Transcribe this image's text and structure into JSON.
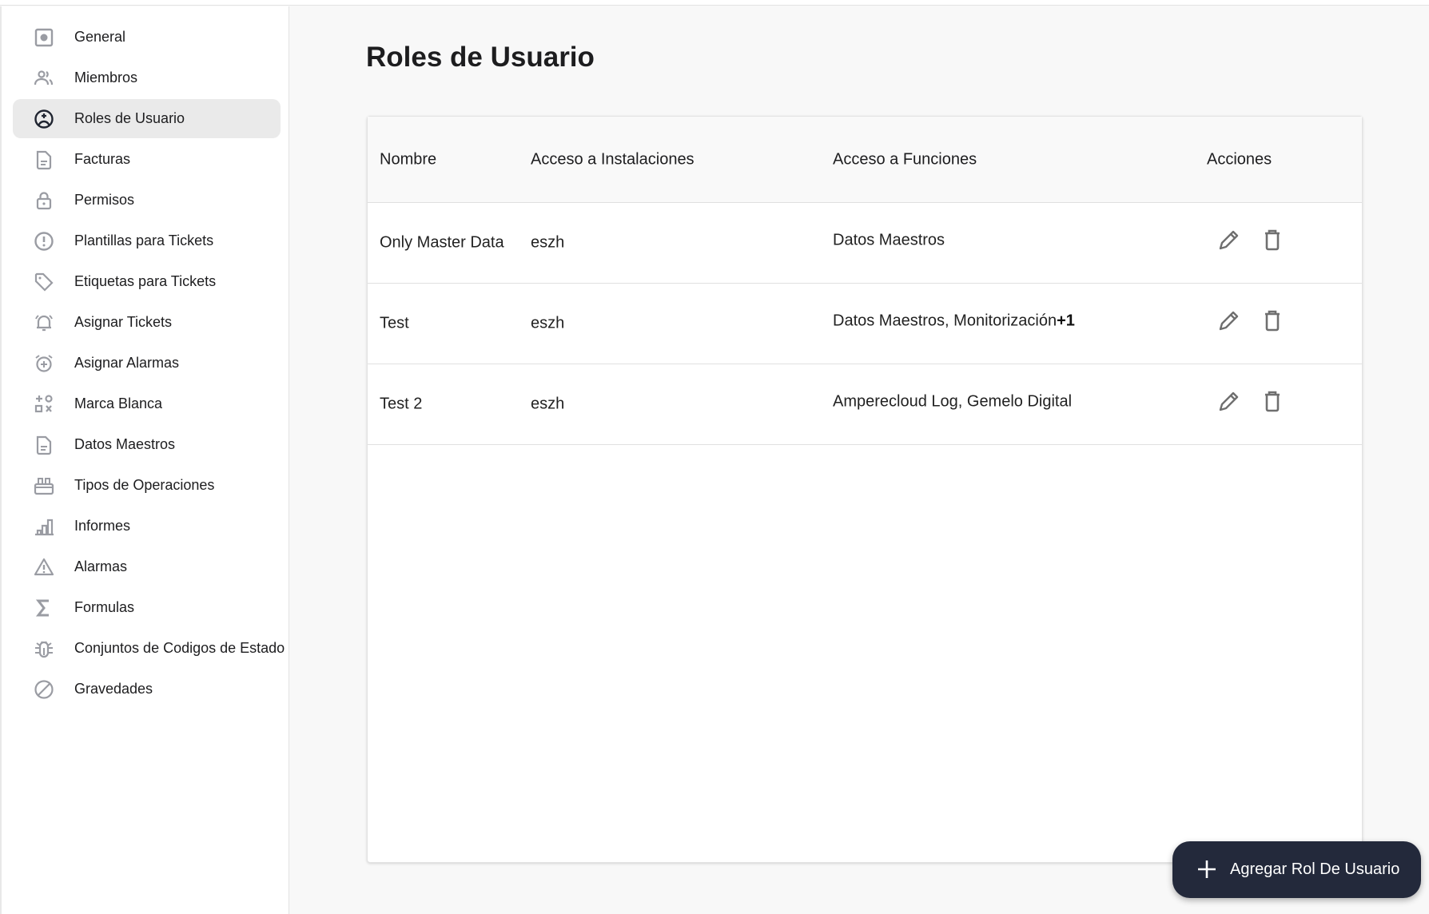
{
  "sidebar": {
    "items": [
      {
        "label": "General",
        "icon": "settings-box-icon",
        "active": false
      },
      {
        "label": "Miembros",
        "icon": "users-icon",
        "active": false
      },
      {
        "label": "Roles de Usuario",
        "icon": "user-circle-icon",
        "active": true
      },
      {
        "label": "Facturas",
        "icon": "document-icon",
        "active": false
      },
      {
        "label": "Permisos",
        "icon": "lock-icon",
        "active": false
      },
      {
        "label": "Plantillas para Tickets",
        "icon": "alert-circle-icon",
        "active": false
      },
      {
        "label": "Etiquetas para Tickets",
        "icon": "tag-icon",
        "active": false
      },
      {
        "label": "Asignar Tickets",
        "icon": "bell-ring-icon",
        "active": false
      },
      {
        "label": "Asignar Alarmas",
        "icon": "alarm-add-icon",
        "active": false
      },
      {
        "label": "Marca Blanca",
        "icon": "shapes-icon",
        "active": false
      },
      {
        "label": "Datos Maestros",
        "icon": "document-icon",
        "active": false
      },
      {
        "label": "Tipos de Operaciones",
        "icon": "toolbox-icon",
        "active": false
      },
      {
        "label": "Informes",
        "icon": "bar-chart-icon",
        "active": false
      },
      {
        "label": "Alarmas",
        "icon": "warning-icon",
        "active": false
      },
      {
        "label": "Formulas",
        "icon": "sigma-icon",
        "active": false
      },
      {
        "label": "Conjuntos de Codigos de Estado",
        "icon": "bug-icon",
        "active": false
      },
      {
        "label": "Gravedades",
        "icon": "block-icon",
        "active": false
      }
    ]
  },
  "main": {
    "title": "Roles de Usuario",
    "table": {
      "headers": [
        "Nombre",
        "Acceso a Instalaciones",
        "Acceso a Funciones",
        "Acciones"
      ],
      "rows": [
        {
          "nombre": "Only Master Data",
          "instalaciones": "eszh",
          "funciones": "Datos Maestros",
          "extra": ""
        },
        {
          "nombre": "Test",
          "instalaciones": "eszh",
          "funciones": "Datos Maestros, Monitorización",
          "extra": "+1"
        },
        {
          "nombre": "Test 2",
          "instalaciones": "eszh",
          "funciones": "Amperecloud Log, Gemelo Digital",
          "extra": ""
        }
      ]
    },
    "add_button_label": "Agregar Rol De Usuario"
  },
  "colors": {
    "accent": "#23293b",
    "active_bg": "#eaeaea",
    "icon_gray": "#9a9ca3"
  }
}
